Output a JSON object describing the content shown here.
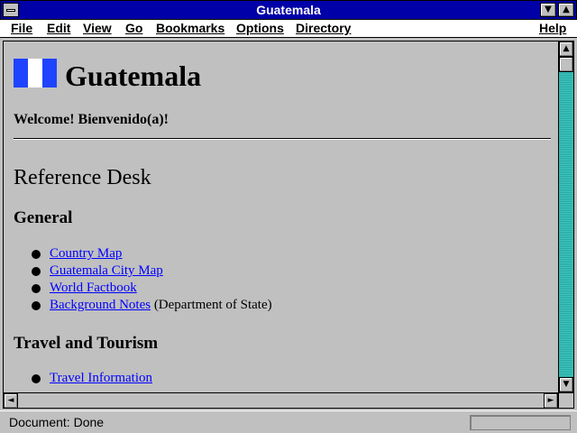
{
  "window": {
    "title": "Guatemala"
  },
  "menu": {
    "file": "File",
    "edit": "Edit",
    "view": "View",
    "go": "Go",
    "bookmarks": "Bookmarks",
    "options": "Options",
    "directory": "Directory",
    "help": "Help"
  },
  "page": {
    "title": "Guatemala",
    "welcome": "Welcome! Bienvenido(a)!",
    "reference_desk": "Reference Desk",
    "general_heading": "General",
    "general_links": [
      {
        "label": "Country Map",
        "note": ""
      },
      {
        "label": "Guatemala City Map",
        "note": ""
      },
      {
        "label": "World Factbook",
        "note": ""
      },
      {
        "label": "Background Notes",
        "note": " (Department of State)"
      }
    ],
    "travel_heading": "Travel and Tourism",
    "travel_links": [
      {
        "label": "Travel Information"
      }
    ]
  },
  "status": {
    "text": "Document: Done"
  },
  "colors": {
    "titlebar": "#0000a8",
    "link": "#0000ff",
    "flag_blue": "#1e44ff",
    "scrollbar": "#20b2aa"
  },
  "icons": {
    "system_menu": "system-menu-icon",
    "minimize": "minimize-arrow-icon",
    "maximize": "maximize-arrow-icon"
  }
}
